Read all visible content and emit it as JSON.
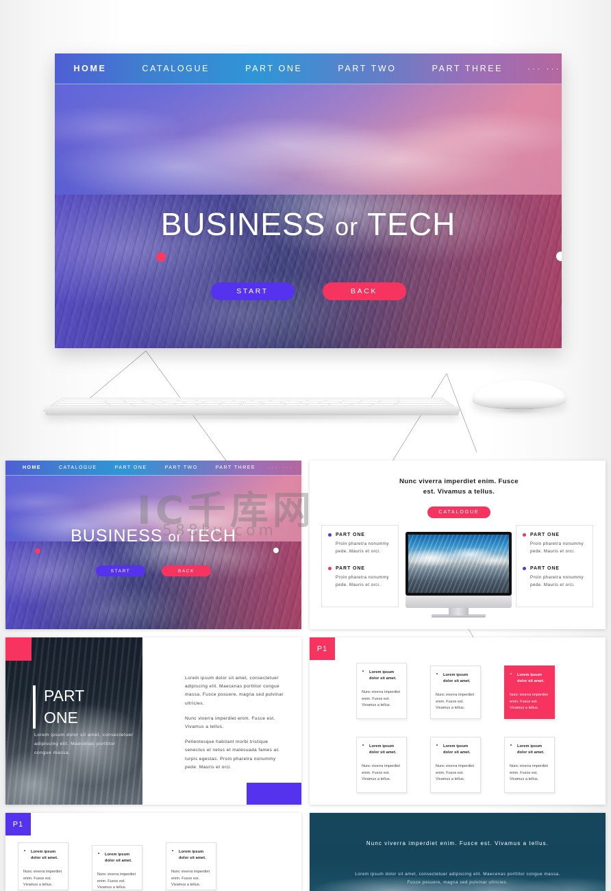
{
  "watermark": {
    "logo": "IC千库网",
    "url": "588ku.com"
  },
  "hero": {
    "nav": [
      {
        "label": "HOME",
        "active": true
      },
      {
        "label": "CATALOGUE",
        "active": false
      },
      {
        "label": "PART ONE",
        "active": false
      },
      {
        "label": "PART TWO",
        "active": false
      },
      {
        "label": "PART THREE",
        "active": false
      }
    ],
    "nav_more": "··· ···",
    "title_main": "BUSINESS",
    "title_or": "or",
    "title_tail": "TECH",
    "btn_start": "START",
    "btn_back": "BACK",
    "accent_violet": "#5533ee",
    "accent_pink": "#f7335f"
  },
  "slide2": {
    "heading": "Nunc viverra imperdiet enim. Fusce est. Vivamus a tellus.",
    "pill": "CATALOGUE",
    "features_left": [
      {
        "title": "PART ONE",
        "body": "Proin pharetra nonummy pede. Mauris et orci.",
        "dot": "violet"
      },
      {
        "title": "PART ONE",
        "body": "Proin pharetra nonummy pede. Mauris et orci.",
        "dot": "pink"
      }
    ],
    "features_right": [
      {
        "title": "PART ONE",
        "body": "Proin pharetra nonummy pede. Mauris et orci.",
        "dot": "pink"
      },
      {
        "title": "PART ONE",
        "body": "Proin pharetra nonummy pede. Mauris et orci.",
        "dot": "violet"
      }
    ],
    "apple_glyph": ""
  },
  "slide3": {
    "title_line1": "PART",
    "title_line2": "ONE",
    "subtitle": "Lorem ipsum dolor sit amet, consectetuer adipiscing elit. Maecenas porttitor congue massa.",
    "paragraphs": [
      "Lorem ipsum dolor sit amet, consectetuer adipiscing elit. Maecenas porttitor congue massa. Fusce posuere, magna sed pulvinar ultricies.",
      "Nunc viverra imperdiet enim. Fusce est. Vivamus a tellus.",
      "Pellentesque habitant morbi tristique senectus et netus et malesuada fames ac turpis egestas. Proin pharetra nonummy pede. Mauris et orci."
    ]
  },
  "slide4": {
    "badge": "P1",
    "cards": [
      {
        "title": "Lorem ipsum dolor sit amet.",
        "body": "Nunc viverra imperdiet enim. Fusce est. Vivamus a tellus.",
        "accent": false
      },
      {
        "title": "Lorem ipsum dolor sit amet.",
        "body": "Nunc viverra imperdiet enim. Fusce est. Vivamus a tellus.",
        "accent": false
      },
      {
        "title": "Lorem ipsum dolor sit amet.",
        "body": "Nunc viverra imperdiet enim. Fusce est. Vivamus a tellus.",
        "accent": true
      },
      {
        "title": "Lorem ipsum dolor sit amet.",
        "body": "Nunc viverra imperdiet enim. Fusce est. Vivamus a tellus.",
        "accent": false
      },
      {
        "title": "Lorem ipsum dolor sit amet.",
        "body": "Nunc viverra imperdiet enim. Fusce est. Vivamus a tellus.",
        "accent": false
      },
      {
        "title": "Lorem ipsum dolor sit amet.",
        "body": "Nunc viverra imperdiet enim. Fusce est. Vivamus a tellus.",
        "accent": false
      }
    ]
  },
  "slide5": {
    "badge": "P1",
    "cards": [
      {
        "title": "Lorem ipsum dolor sit amet.",
        "body": "Nunc viverra imperdiet enim. Fusce est. Vivamus a tellus."
      },
      {
        "title": "Lorem ipsum dolor sit amet.",
        "body": "Nunc viverra imperdiet enim. Fusce est. Vivamus a tellus."
      },
      {
        "title": "Lorem ipsum dolor sit amet.",
        "body": "Nunc viverra imperdiet enim. Fusce est. Vivamus a tellus."
      }
    ]
  },
  "slide6": {
    "heading": "Nunc viverra imperdiet enim. Fusce est. Vivamus a tellus.",
    "subtitle": "Lorem ipsum dolor sit amet, consectetuer adipiscing elit. Maecenas porttitor congue massa. Fusce posuere, magna sed pulvinar ultricies."
  }
}
